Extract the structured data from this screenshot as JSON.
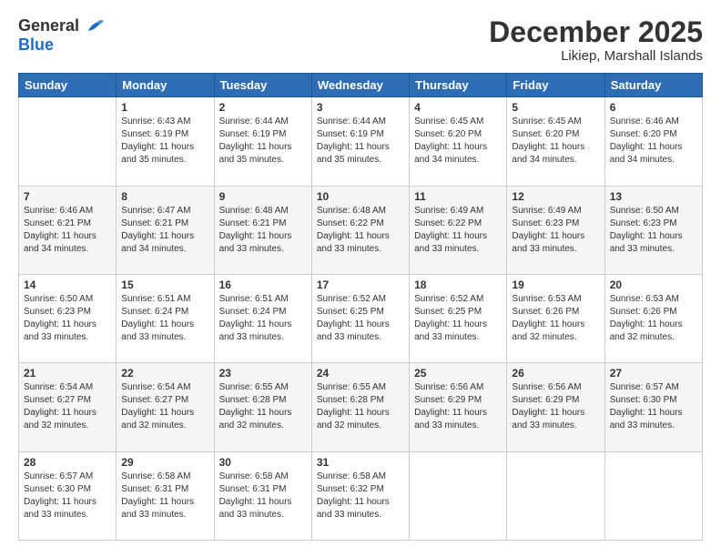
{
  "logo": {
    "general": "General",
    "blue": "Blue"
  },
  "title": "December 2025",
  "location": "Likiep, Marshall Islands",
  "days_of_week": [
    "Sunday",
    "Monday",
    "Tuesday",
    "Wednesday",
    "Thursday",
    "Friday",
    "Saturday"
  ],
  "weeks": [
    [
      {
        "day": "",
        "sunrise": "",
        "sunset": "",
        "daylight": ""
      },
      {
        "day": "1",
        "sunrise": "Sunrise: 6:43 AM",
        "sunset": "Sunset: 6:19 PM",
        "daylight": "Daylight: 11 hours and 35 minutes."
      },
      {
        "day": "2",
        "sunrise": "Sunrise: 6:44 AM",
        "sunset": "Sunset: 6:19 PM",
        "daylight": "Daylight: 11 hours and 35 minutes."
      },
      {
        "day": "3",
        "sunrise": "Sunrise: 6:44 AM",
        "sunset": "Sunset: 6:19 PM",
        "daylight": "Daylight: 11 hours and 35 minutes."
      },
      {
        "day": "4",
        "sunrise": "Sunrise: 6:45 AM",
        "sunset": "Sunset: 6:20 PM",
        "daylight": "Daylight: 11 hours and 34 minutes."
      },
      {
        "day": "5",
        "sunrise": "Sunrise: 6:45 AM",
        "sunset": "Sunset: 6:20 PM",
        "daylight": "Daylight: 11 hours and 34 minutes."
      },
      {
        "day": "6",
        "sunrise": "Sunrise: 6:46 AM",
        "sunset": "Sunset: 6:20 PM",
        "daylight": "Daylight: 11 hours and 34 minutes."
      }
    ],
    [
      {
        "day": "7",
        "sunrise": "Sunrise: 6:46 AM",
        "sunset": "Sunset: 6:21 PM",
        "daylight": "Daylight: 11 hours and 34 minutes."
      },
      {
        "day": "8",
        "sunrise": "Sunrise: 6:47 AM",
        "sunset": "Sunset: 6:21 PM",
        "daylight": "Daylight: 11 hours and 34 minutes."
      },
      {
        "day": "9",
        "sunrise": "Sunrise: 6:48 AM",
        "sunset": "Sunset: 6:21 PM",
        "daylight": "Daylight: 11 hours and 33 minutes."
      },
      {
        "day": "10",
        "sunrise": "Sunrise: 6:48 AM",
        "sunset": "Sunset: 6:22 PM",
        "daylight": "Daylight: 11 hours and 33 minutes."
      },
      {
        "day": "11",
        "sunrise": "Sunrise: 6:49 AM",
        "sunset": "Sunset: 6:22 PM",
        "daylight": "Daylight: 11 hours and 33 minutes."
      },
      {
        "day": "12",
        "sunrise": "Sunrise: 6:49 AM",
        "sunset": "Sunset: 6:23 PM",
        "daylight": "Daylight: 11 hours and 33 minutes."
      },
      {
        "day": "13",
        "sunrise": "Sunrise: 6:50 AM",
        "sunset": "Sunset: 6:23 PM",
        "daylight": "Daylight: 11 hours and 33 minutes."
      }
    ],
    [
      {
        "day": "14",
        "sunrise": "Sunrise: 6:50 AM",
        "sunset": "Sunset: 6:23 PM",
        "daylight": "Daylight: 11 hours and 33 minutes."
      },
      {
        "day": "15",
        "sunrise": "Sunrise: 6:51 AM",
        "sunset": "Sunset: 6:24 PM",
        "daylight": "Daylight: 11 hours and 33 minutes."
      },
      {
        "day": "16",
        "sunrise": "Sunrise: 6:51 AM",
        "sunset": "Sunset: 6:24 PM",
        "daylight": "Daylight: 11 hours and 33 minutes."
      },
      {
        "day": "17",
        "sunrise": "Sunrise: 6:52 AM",
        "sunset": "Sunset: 6:25 PM",
        "daylight": "Daylight: 11 hours and 33 minutes."
      },
      {
        "day": "18",
        "sunrise": "Sunrise: 6:52 AM",
        "sunset": "Sunset: 6:25 PM",
        "daylight": "Daylight: 11 hours and 33 minutes."
      },
      {
        "day": "19",
        "sunrise": "Sunrise: 6:53 AM",
        "sunset": "Sunset: 6:26 PM",
        "daylight": "Daylight: 11 hours and 32 minutes."
      },
      {
        "day": "20",
        "sunrise": "Sunrise: 6:53 AM",
        "sunset": "Sunset: 6:26 PM",
        "daylight": "Daylight: 11 hours and 32 minutes."
      }
    ],
    [
      {
        "day": "21",
        "sunrise": "Sunrise: 6:54 AM",
        "sunset": "Sunset: 6:27 PM",
        "daylight": "Daylight: 11 hours and 32 minutes."
      },
      {
        "day": "22",
        "sunrise": "Sunrise: 6:54 AM",
        "sunset": "Sunset: 6:27 PM",
        "daylight": "Daylight: 11 hours and 32 minutes."
      },
      {
        "day": "23",
        "sunrise": "Sunrise: 6:55 AM",
        "sunset": "Sunset: 6:28 PM",
        "daylight": "Daylight: 11 hours and 32 minutes."
      },
      {
        "day": "24",
        "sunrise": "Sunrise: 6:55 AM",
        "sunset": "Sunset: 6:28 PM",
        "daylight": "Daylight: 11 hours and 32 minutes."
      },
      {
        "day": "25",
        "sunrise": "Sunrise: 6:56 AM",
        "sunset": "Sunset: 6:29 PM",
        "daylight": "Daylight: 11 hours and 33 minutes."
      },
      {
        "day": "26",
        "sunrise": "Sunrise: 6:56 AM",
        "sunset": "Sunset: 6:29 PM",
        "daylight": "Daylight: 11 hours and 33 minutes."
      },
      {
        "day": "27",
        "sunrise": "Sunrise: 6:57 AM",
        "sunset": "Sunset: 6:30 PM",
        "daylight": "Daylight: 11 hours and 33 minutes."
      }
    ],
    [
      {
        "day": "28",
        "sunrise": "Sunrise: 6:57 AM",
        "sunset": "Sunset: 6:30 PM",
        "daylight": "Daylight: 11 hours and 33 minutes."
      },
      {
        "day": "29",
        "sunrise": "Sunrise: 6:58 AM",
        "sunset": "Sunset: 6:31 PM",
        "daylight": "Daylight: 11 hours and 33 minutes."
      },
      {
        "day": "30",
        "sunrise": "Sunrise: 6:58 AM",
        "sunset": "Sunset: 6:31 PM",
        "daylight": "Daylight: 11 hours and 33 minutes."
      },
      {
        "day": "31",
        "sunrise": "Sunrise: 6:58 AM",
        "sunset": "Sunset: 6:32 PM",
        "daylight": "Daylight: 11 hours and 33 minutes."
      },
      {
        "day": "",
        "sunrise": "",
        "sunset": "",
        "daylight": ""
      },
      {
        "day": "",
        "sunrise": "",
        "sunset": "",
        "daylight": ""
      },
      {
        "day": "",
        "sunrise": "",
        "sunset": "",
        "daylight": ""
      }
    ]
  ]
}
